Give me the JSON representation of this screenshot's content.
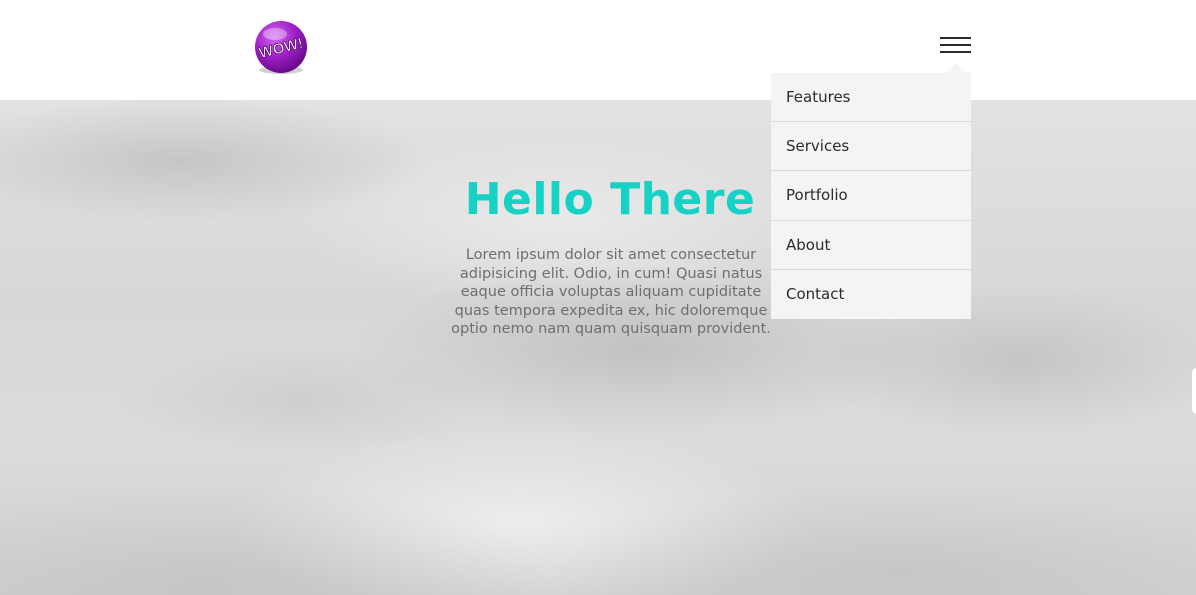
{
  "header": {
    "logo_text": "WOW!",
    "menu_toggle_icon": "hamburger-icon"
  },
  "menu": {
    "items": [
      {
        "label": "Features"
      },
      {
        "label": "Services"
      },
      {
        "label": "Portfolio"
      },
      {
        "label": "About"
      },
      {
        "label": "Contact"
      }
    ]
  },
  "hero": {
    "title": "Hello There",
    "text": "Lorem ipsum dolor sit amet consectetur adipisicing elit. Odio, in cum! Quasi natus eaque officia voluptas aliquam cupiditate quas tempora expedita ex, hic doloremque optio nemo nam quam quisquam provident."
  },
  "colors": {
    "accent": "#16d2c4",
    "logo_purple": "#a020c8",
    "menu_background": "#f4f4f4",
    "body_text": "#6e6e6e"
  }
}
